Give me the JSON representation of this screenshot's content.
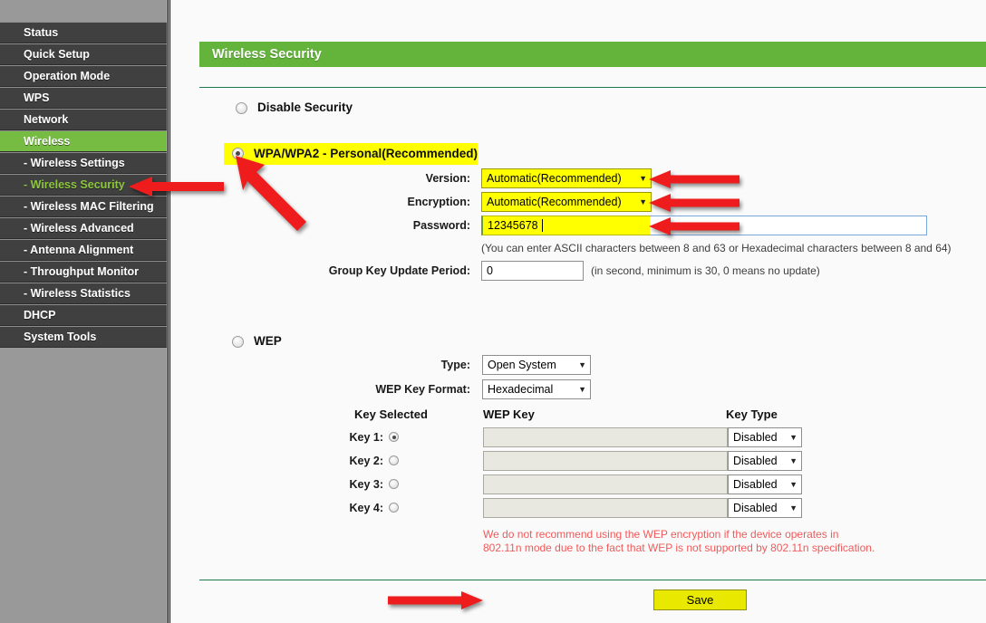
{
  "sidebar": {
    "items": [
      {
        "label": "Status",
        "level": "top",
        "state": "normal"
      },
      {
        "label": "Quick Setup",
        "level": "top",
        "state": "normal"
      },
      {
        "label": "Operation Mode",
        "level": "top",
        "state": "normal"
      },
      {
        "label": "WPS",
        "level": "top",
        "state": "normal"
      },
      {
        "label": "Network",
        "level": "top",
        "state": "normal"
      },
      {
        "label": "Wireless",
        "level": "top",
        "state": "selected"
      },
      {
        "label": "- Wireless Settings",
        "level": "sub",
        "state": "normal"
      },
      {
        "label": "- Wireless Security",
        "level": "sub",
        "state": "current"
      },
      {
        "label": "- Wireless MAC Filtering",
        "level": "sub",
        "state": "normal"
      },
      {
        "label": "- Wireless Advanced",
        "level": "sub",
        "state": "normal"
      },
      {
        "label": "- Antenna Alignment",
        "level": "sub",
        "state": "normal"
      },
      {
        "label": "- Throughput Monitor",
        "level": "sub",
        "state": "normal"
      },
      {
        "label": "- Wireless Statistics",
        "level": "sub",
        "state": "normal"
      },
      {
        "label": "DHCP",
        "level": "top",
        "state": "normal"
      },
      {
        "label": "System Tools",
        "level": "top",
        "state": "normal"
      }
    ]
  },
  "page": {
    "title": "Wireless Security",
    "accent_green": "#64b43c",
    "divider_green": "#1e7a4a",
    "highlight_yellow": "#ffff00",
    "arrow_red": "#ee1c1c"
  },
  "disable_security": {
    "label": "Disable Security",
    "checked": false
  },
  "wpa": {
    "label": "WPA/WPA2 - Personal(Recommended)",
    "checked": true,
    "version_label": "Version:",
    "version_value": "Automatic(Recommended)",
    "encryption_label": "Encryption:",
    "encryption_value": "Automatic(Recommended)",
    "password_label": "Password:",
    "password_value": "12345678",
    "password_hint": "(You can enter ASCII characters between 8 and 63 or Hexadecimal characters between 8 and 64)",
    "group_key_label": "Group Key Update Period:",
    "group_key_value": "0",
    "group_key_hint": "(in second, minimum is 30, 0 means no update)"
  },
  "wep": {
    "label": "WEP",
    "checked": false,
    "type_label": "Type:",
    "type_value": "Open System",
    "key_format_label": "WEP Key Format:",
    "key_format_value": "Hexadecimal",
    "columns": {
      "key_selected": "Key Selected",
      "wep_key": "WEP Key",
      "key_type": "Key Type"
    },
    "keys": [
      {
        "label": "Key 1:",
        "selected": true,
        "value": "",
        "type": "Disabled"
      },
      {
        "label": "Key 2:",
        "selected": false,
        "value": "",
        "type": "Disabled"
      },
      {
        "label": "Key 3:",
        "selected": false,
        "value": "",
        "type": "Disabled"
      },
      {
        "label": "Key 4:",
        "selected": false,
        "value": "",
        "type": "Disabled"
      }
    ],
    "warning_line1": "We do not recommend using the WEP encryption if the device operates in",
    "warning_line2": "802.11n mode due to the fact that WEP is not supported by 802.11n specification."
  },
  "footer": {
    "save_label": "Save"
  },
  "annotations": {
    "arrow_sidebar": "arrow-pointing-left-icon",
    "arrow_wpa_radio": "arrow-pointing-up-left-icon",
    "arrow_version": "arrow-pointing-left-icon",
    "arrow_encryption": "arrow-pointing-left-icon",
    "arrow_password": "arrow-pointing-left-icon",
    "arrow_save": "arrow-pointing-right-icon"
  }
}
